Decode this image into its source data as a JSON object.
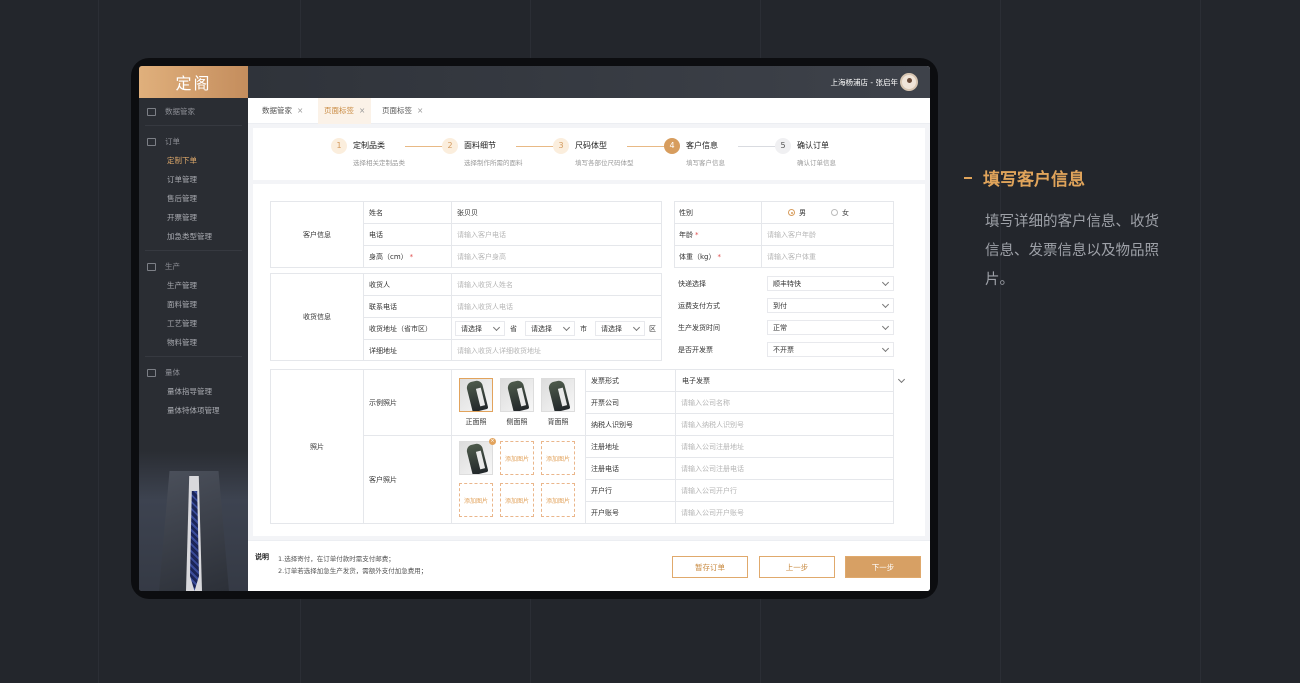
{
  "sidebar": {
    "logo": "定阁",
    "top_item": "数据管家",
    "sections": [
      {
        "title": "订单",
        "items": [
          "定制下单",
          "订单管理",
          "售后管理",
          "开票管理",
          "加急类型管理"
        ]
      },
      {
        "title": "生产",
        "items": [
          "生产管理",
          "面料管理",
          "工艺管理",
          "物料管理"
        ]
      },
      {
        "title": "量体",
        "items": [
          "量体指导管理",
          "量体特体项管理"
        ]
      }
    ]
  },
  "topbar": {
    "user": "上海杨浦店 - 张启年"
  },
  "tabs": [
    {
      "label": "数据管家",
      "close": "×"
    },
    {
      "label": "页面标签",
      "close": "×"
    },
    {
      "label": "页面标签",
      "close": "×"
    }
  ],
  "steps": [
    {
      "num": "1",
      "title": "定制品类",
      "desc": "选择相关定制品类"
    },
    {
      "num": "2",
      "title": "面料细节",
      "desc": "选择制作所需的面料"
    },
    {
      "num": "3",
      "title": "尺码体型",
      "desc": "填写各部位尺码体型"
    },
    {
      "num": "4",
      "title": "客户信息",
      "desc": "填写客户信息"
    },
    {
      "num": "5",
      "title": "确认订单",
      "desc": "确认订单信息"
    }
  ],
  "customer": {
    "section": "客户信息",
    "name_label": "姓名",
    "name_value": "张贝贝",
    "phone_label": "电话",
    "phone_ph": "请输入客户电话",
    "height_label": "身高（cm）",
    "height_ph": "请输入客户身高",
    "gender_label": "性别",
    "gender_male": "男",
    "gender_female": "女",
    "age_label": "年龄",
    "age_ph": "请输入客户年龄",
    "weight_label": "体重（kg）",
    "weight_ph": "请输入客户体重",
    "req": "*"
  },
  "shipping": {
    "section": "收货信息",
    "receiver_label": "收货人",
    "receiver_ph": "请输入收货人姓名",
    "phone_label": "联系电话",
    "phone_ph": "请输入收货人电话",
    "addr_label": "收货地址（省市区）",
    "select_ph": "请选择",
    "prov": "省",
    "city": "市",
    "dist": "区",
    "detail_label": "详细地址",
    "detail_ph": "请输入收货人详细收货地址",
    "express_label": "快递选择",
    "express_value": "顺丰特快",
    "pay_label": "运费支付方式",
    "pay_value": "到付",
    "ship_time_label": "生产发货时间",
    "ship_time_value": "正常",
    "invoice_label": "是否开发票",
    "invoice_value": "不开票"
  },
  "photos": {
    "section": "照片",
    "sample_label": "示例照片",
    "captions": [
      "正面照",
      "侧面照",
      "背面照"
    ],
    "customer_label": "客户照片",
    "add_label": "添加图片",
    "del": "×"
  },
  "invoice": {
    "type_label": "发票形式",
    "type_value": "电子发票",
    "company_label": "开票公司",
    "company_ph": "请输入公司名称",
    "tax_label": "纳税人识别号",
    "tax_ph": "请输入纳税人识别号",
    "addr_label": "注册地址",
    "addr_ph": "请输入公司注册地址",
    "tel_label": "注册电话",
    "tel_ph": "请输入公司注册电话",
    "bank_label": "开户行",
    "bank_ph": "请输入公司开户行",
    "account_label": "开户账号",
    "account_ph": "请输入公司开户账号"
  },
  "footer": {
    "notes_title": "说明",
    "note1": "1.选择寄付，在订单付款时需支付邮费；",
    "note2": "2.订单若选择加急生产发货，需额外支付加急费用；",
    "save": "暂存订单",
    "prev": "上一步",
    "next": "下一步"
  },
  "right": {
    "title": "填写客户信息",
    "desc": "填写详细的客户信息、收货信息、发票信息以及物品照片。"
  },
  "colors": {
    "accent": "#d79d5e",
    "bg": "#23262c",
    "sidebar": "#2a2d33"
  }
}
